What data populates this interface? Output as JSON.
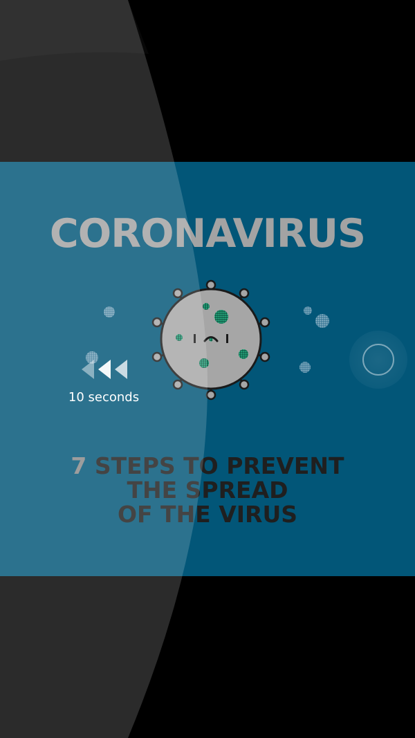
{
  "video": {
    "title": "CORONAVIRUS",
    "subtitle": {
      "number": "7",
      "line1_rest": "STEPS TO PREVENT",
      "line2": "THE SPREAD",
      "line3": "OF THE VIRUS"
    },
    "character": "virus-character-icon"
  },
  "seek_back": {
    "icon": "rewind-icon",
    "label": "10 seconds"
  },
  "seek_forward": {
    "icon": "tap-ripple-icon"
  },
  "colors": {
    "background": "#000000",
    "video_blue": "#025678",
    "title_gray": "#a3a3a3",
    "subtitle_dark": "#1f1f1f",
    "virus_gray": "#a6a6a6",
    "virus_spots": "#1f9a6d"
  }
}
